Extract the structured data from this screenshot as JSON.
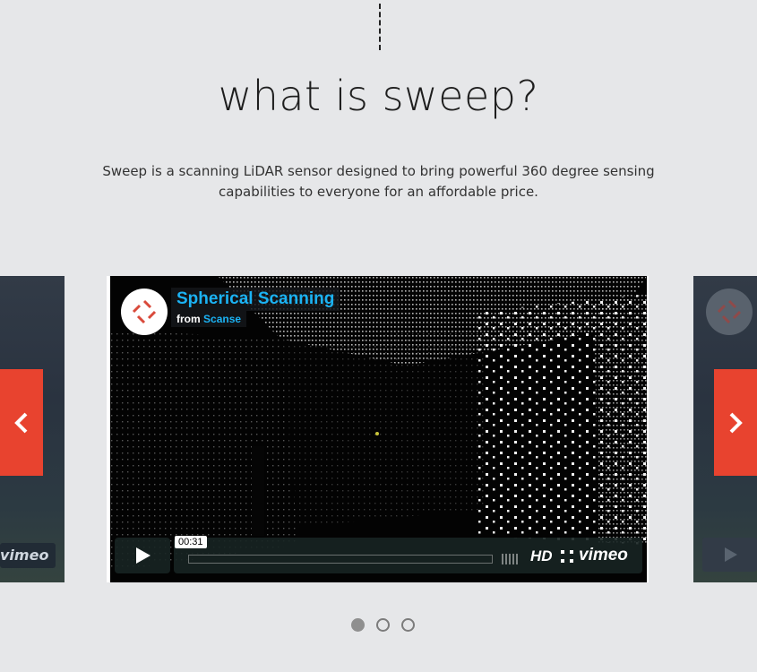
{
  "section": {
    "heading": "what is sweep?",
    "description": "Sweep is a scanning LiDAR sensor designed to bring powerful 360 degree sensing capabilities to everyone for an affordable price."
  },
  "video": {
    "title": "Spherical Scanning",
    "byline_prefix": "from",
    "owner": "Scanse",
    "time_tooltip": "00:31",
    "hd_label": "HD",
    "player_brand": "vimeo",
    "progress_fraction": 0.0
  },
  "side_slide": {
    "player_brand": "vimeo"
  },
  "carousel": {
    "slides": 3,
    "active_index": 0
  },
  "icons": {
    "prev": "chevron-left-icon",
    "next": "chevron-right-icon",
    "play": "play-icon",
    "fullscreen": "fullscreen-icon",
    "logo": "scanse-logo"
  },
  "colors": {
    "accent": "#e8432f",
    "link_blue": "#1bb3f4",
    "background": "#e6e7e9"
  }
}
